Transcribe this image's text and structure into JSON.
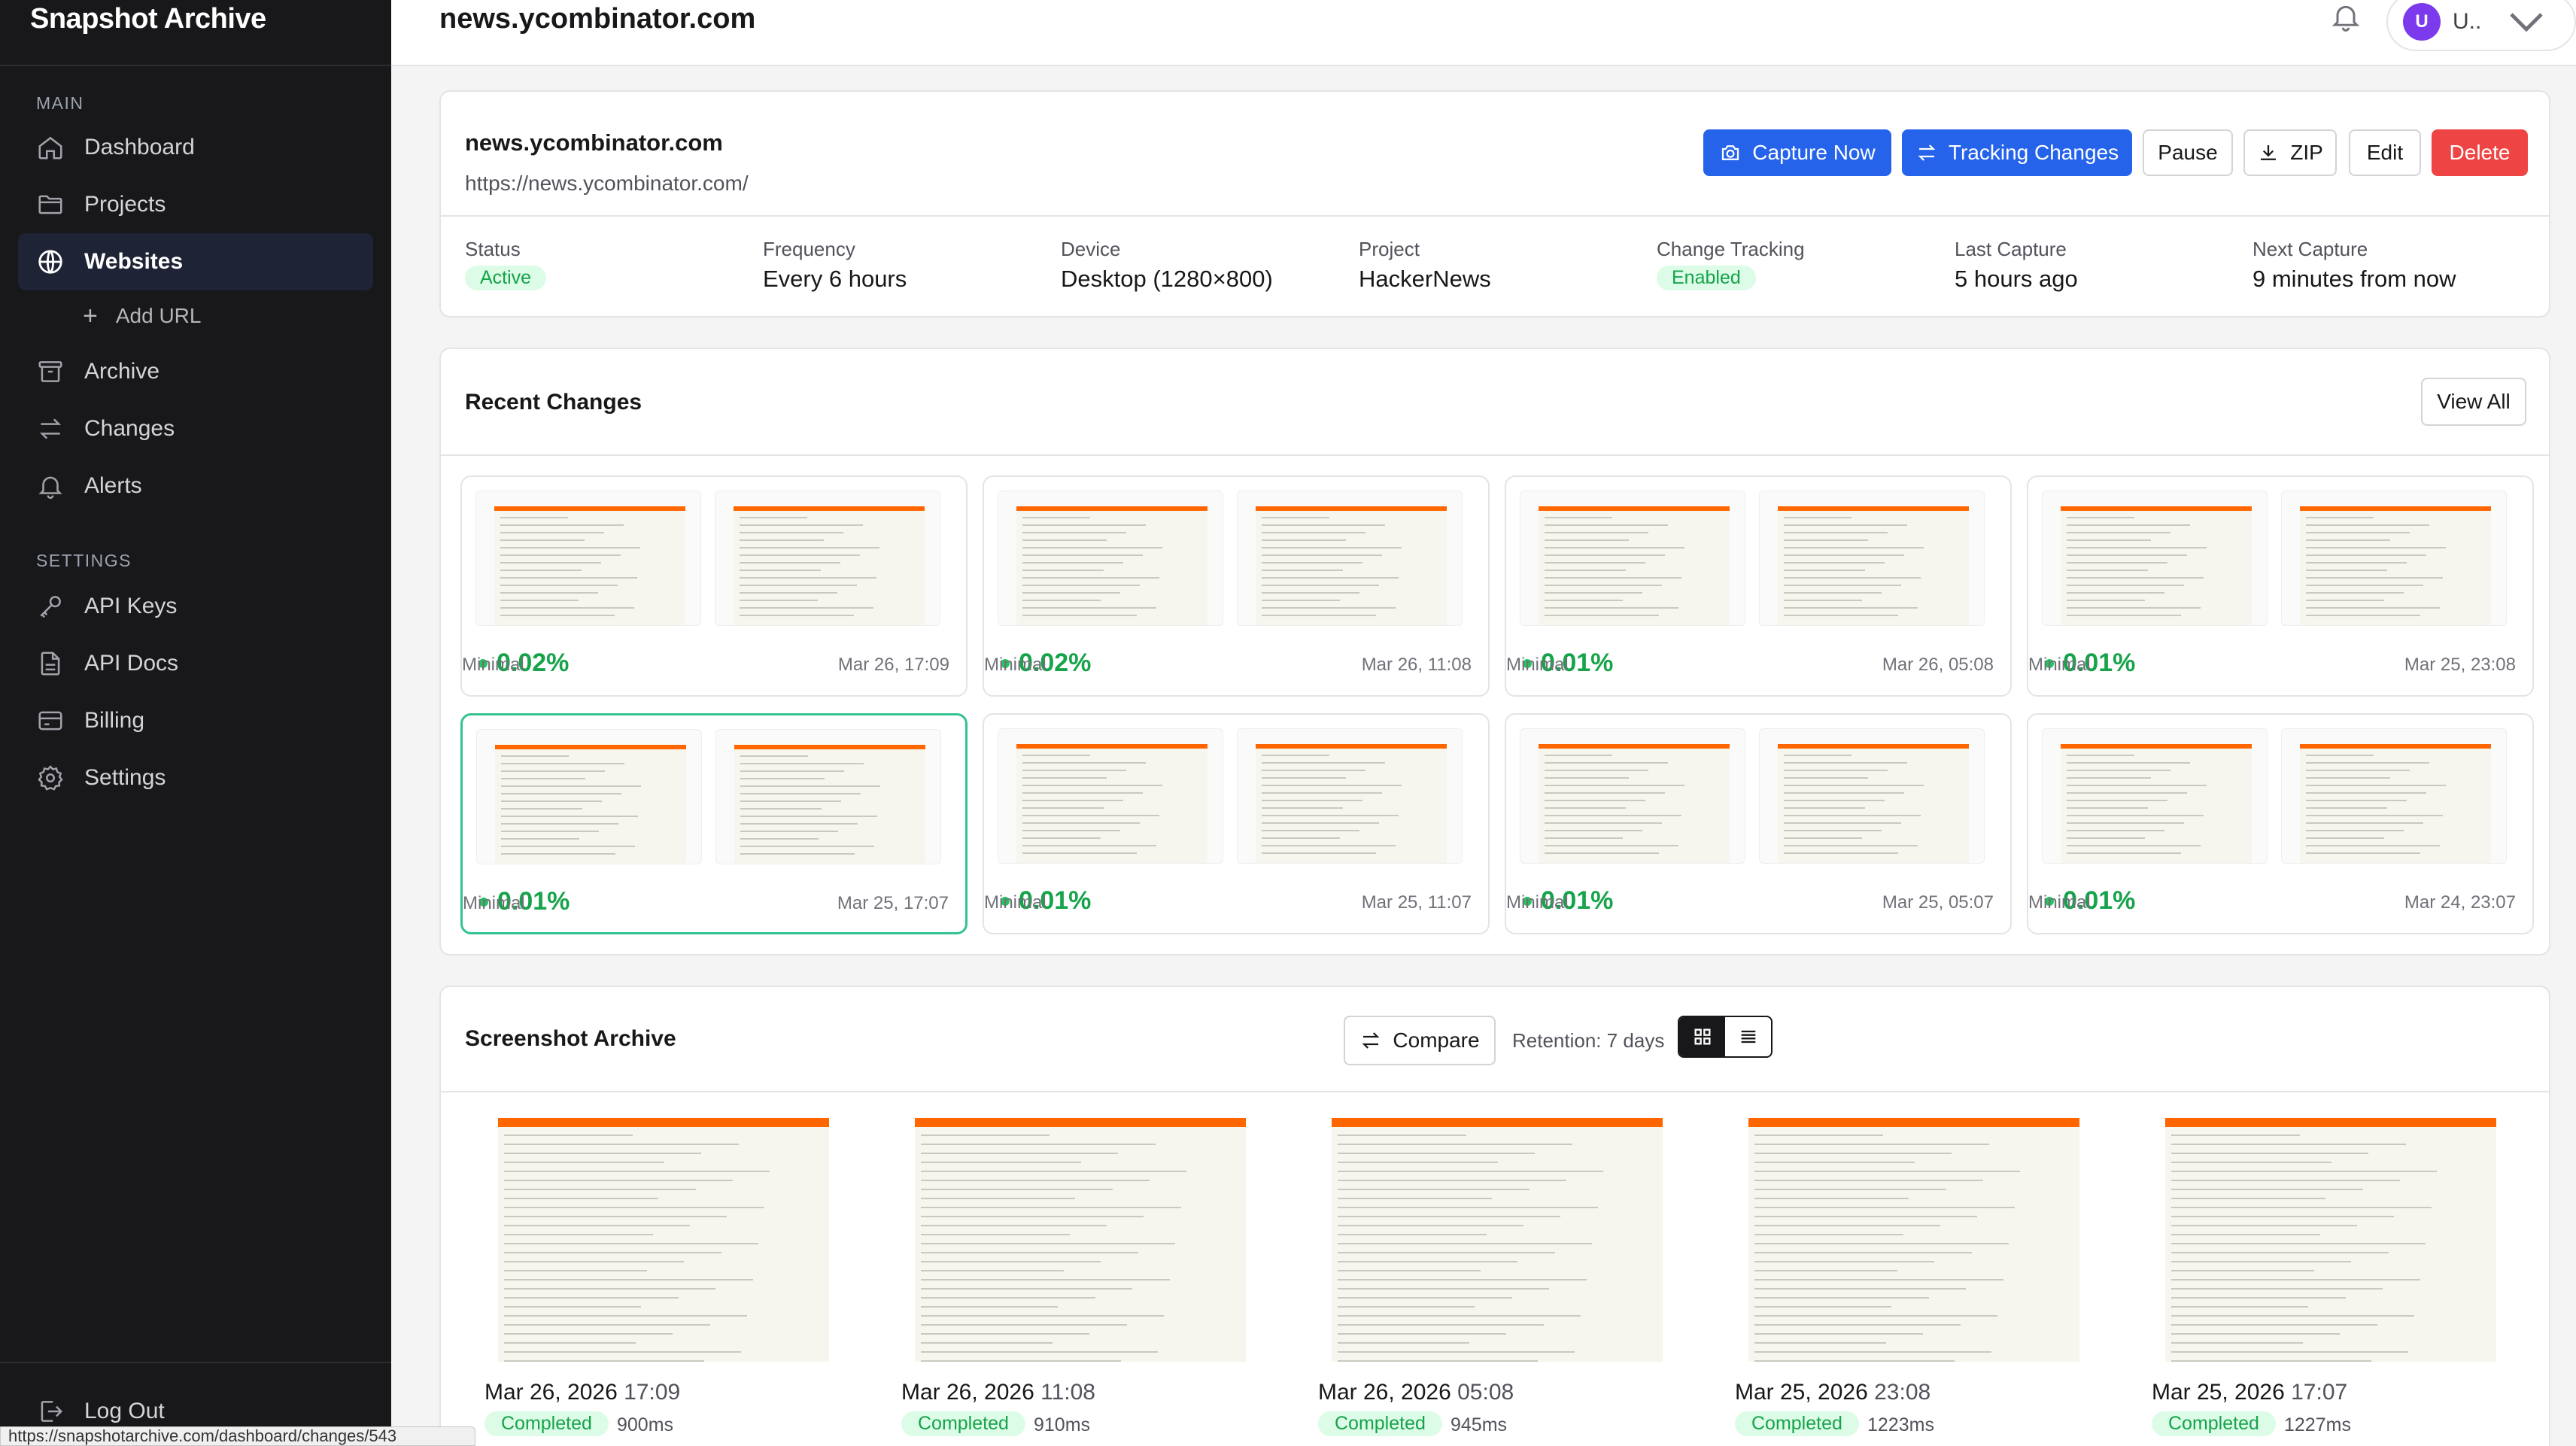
{
  "app": {
    "brand": "Snapshot Archive"
  },
  "sidebar": {
    "main_label": "MAIN",
    "settings_label": "SETTINGS",
    "items": [
      {
        "label": "Dashboard",
        "icon": "home-icon"
      },
      {
        "label": "Projects",
        "icon": "folder-icon"
      },
      {
        "label": "Websites",
        "icon": "globe-icon",
        "active": true
      },
      {
        "label": "Add URL",
        "icon": "plus-icon"
      },
      {
        "label": "Archive",
        "icon": "archive-icon"
      },
      {
        "label": "Changes",
        "icon": "arrows-swap-icon"
      },
      {
        "label": "Alerts",
        "icon": "bell-icon"
      },
      {
        "label": "API Keys",
        "icon": "key-icon"
      },
      {
        "label": "API Docs",
        "icon": "document-icon"
      },
      {
        "label": "Billing",
        "icon": "credit-card-icon"
      },
      {
        "label": "Settings",
        "icon": "gear-icon"
      }
    ],
    "logout": "Log Out"
  },
  "header": {
    "title": "news.ycombinator.com",
    "user_avatar": "U",
    "user_name": "U.."
  },
  "site": {
    "name": "news.ycombinator.com",
    "url": "https://news.ycombinator.com/",
    "actions": {
      "capture": "Capture Now",
      "tracking": "Tracking Changes",
      "pause": "Pause",
      "zip": "ZIP",
      "edit": "Edit",
      "delete": "Delete"
    },
    "stats": [
      {
        "label": "Status",
        "value": "Active",
        "badge": true
      },
      {
        "label": "Frequency",
        "value": "Every 6 hours"
      },
      {
        "label": "Device",
        "value": "Desktop (1280×800)"
      },
      {
        "label": "Project",
        "value": "HackerNews"
      },
      {
        "label": "Change Tracking",
        "value": "Enabled",
        "badge": true
      },
      {
        "label": "Last Capture",
        "value": "5 hours ago"
      },
      {
        "label": "Next Capture",
        "value": "9 minutes from now"
      }
    ]
  },
  "changes": {
    "title": "Recent Changes",
    "view_all": "View All",
    "items": [
      {
        "pct": "0.02%",
        "level": "Minimal",
        "date": "Mar 26, 17:09"
      },
      {
        "pct": "0.02%",
        "level": "Minimal",
        "date": "Mar 26, 11:08"
      },
      {
        "pct": "0.01%",
        "level": "Minimal",
        "date": "Mar 26, 05:08"
      },
      {
        "pct": "0.01%",
        "level": "Minimal",
        "date": "Mar 25, 23:08"
      },
      {
        "pct": "0.01%",
        "level": "Minimal",
        "date": "Mar 25, 17:07",
        "selected": true
      },
      {
        "pct": "0.01%",
        "level": "Minimal",
        "date": "Mar 25, 11:07"
      },
      {
        "pct": "0.01%",
        "level": "Minimal",
        "date": "Mar 25, 05:07"
      },
      {
        "pct": "0.01%",
        "level": "Minimal",
        "date": "Mar 24, 23:07"
      }
    ]
  },
  "archive": {
    "title": "Screenshot Archive",
    "compare": "Compare",
    "retention": "Retention: 7 days",
    "items": [
      {
        "date": "Mar 26, 2026",
        "time": "17:09",
        "status": "Completed",
        "ms": "900ms"
      },
      {
        "date": "Mar 26, 2026",
        "time": "11:08",
        "status": "Completed",
        "ms": "910ms"
      },
      {
        "date": "Mar 26, 2026",
        "time": "05:08",
        "status": "Completed",
        "ms": "945ms"
      },
      {
        "date": "Mar 25, 2026",
        "time": "23:08",
        "status": "Completed",
        "ms": "1223ms"
      },
      {
        "date": "Mar 25, 2026",
        "time": "17:07",
        "status": "Completed",
        "ms": "1227ms"
      }
    ]
  },
  "statusbar": {
    "url": "https://snapshotarchive.com/dashboard/changes/543"
  },
  "colors": {
    "accent": "#2563eb",
    "danger": "#ef4444",
    "success": "#16a34a",
    "sidebar_bg": "#18181b"
  }
}
